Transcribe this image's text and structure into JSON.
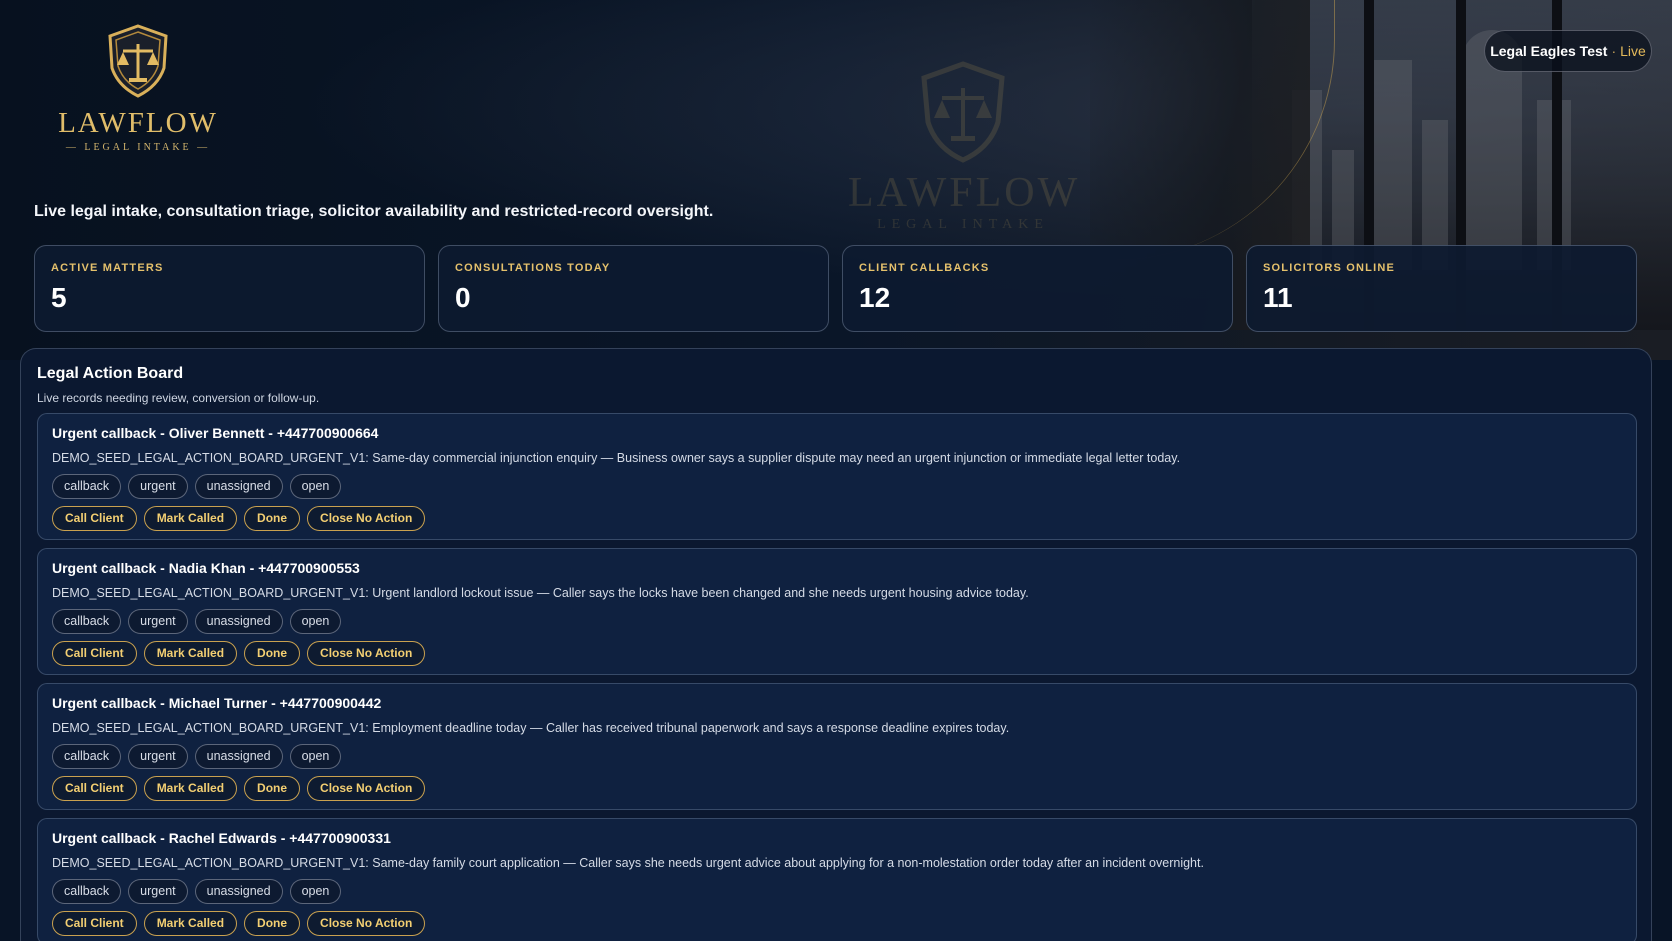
{
  "brand": {
    "name": "LAWFLOW",
    "subtitle": "LEGAL INTAKE",
    "tagline": "Live legal intake, consultation triage, solicitor availability and restricted-record oversight.",
    "accent": "#e0bd6a"
  },
  "tenant": {
    "name": "Legal Eagles Test",
    "separator": "·",
    "status": "Live"
  },
  "stats": [
    {
      "label": "ACTIVE MATTERS",
      "value": "5"
    },
    {
      "label": "CONSULTATIONS TODAY",
      "value": "0"
    },
    {
      "label": "CLIENT CALLBACKS",
      "value": "12"
    },
    {
      "label": "SOLICITORS ONLINE",
      "value": "11"
    }
  ],
  "board": {
    "title": "Legal Action Board",
    "subtitle": "Live records needing review, conversion or follow-up.",
    "records": [
      {
        "title": "Urgent callback - Oliver Bennett - +447700900664",
        "description": "DEMO_SEED_LEGAL_ACTION_BOARD_URGENT_V1: Same-day commercial injunction enquiry — Business owner says a supplier dispute may need an urgent injunction or immediate legal letter today.",
        "tags": [
          "callback",
          "urgent",
          "unassigned",
          "open"
        ],
        "actions": [
          "Call Client",
          "Mark Called",
          "Done",
          "Close No Action"
        ]
      },
      {
        "title": "Urgent callback - Nadia Khan - +447700900553",
        "description": "DEMO_SEED_LEGAL_ACTION_BOARD_URGENT_V1: Urgent landlord lockout issue — Caller says the locks have been changed and she needs urgent housing advice today.",
        "tags": [
          "callback",
          "urgent",
          "unassigned",
          "open"
        ],
        "actions": [
          "Call Client",
          "Mark Called",
          "Done",
          "Close No Action"
        ]
      },
      {
        "title": "Urgent callback - Michael Turner - +447700900442",
        "description": "DEMO_SEED_LEGAL_ACTION_BOARD_URGENT_V1: Employment deadline today — Caller has received tribunal paperwork and says a response deadline expires today.",
        "tags": [
          "callback",
          "urgent",
          "unassigned",
          "open"
        ],
        "actions": [
          "Call Client",
          "Mark Called",
          "Done",
          "Close No Action"
        ]
      },
      {
        "title": "Urgent callback - Rachel Edwards - +447700900331",
        "description": "DEMO_SEED_LEGAL_ACTION_BOARD_URGENT_V1: Same-day family court application — Caller says she needs urgent advice about applying for a non-molestation order today after an incident overnight.",
        "tags": [
          "callback",
          "urgent",
          "unassigned",
          "open"
        ],
        "actions": [
          "Call Client",
          "Mark Called",
          "Done",
          "Close No Action"
        ]
      }
    ]
  }
}
